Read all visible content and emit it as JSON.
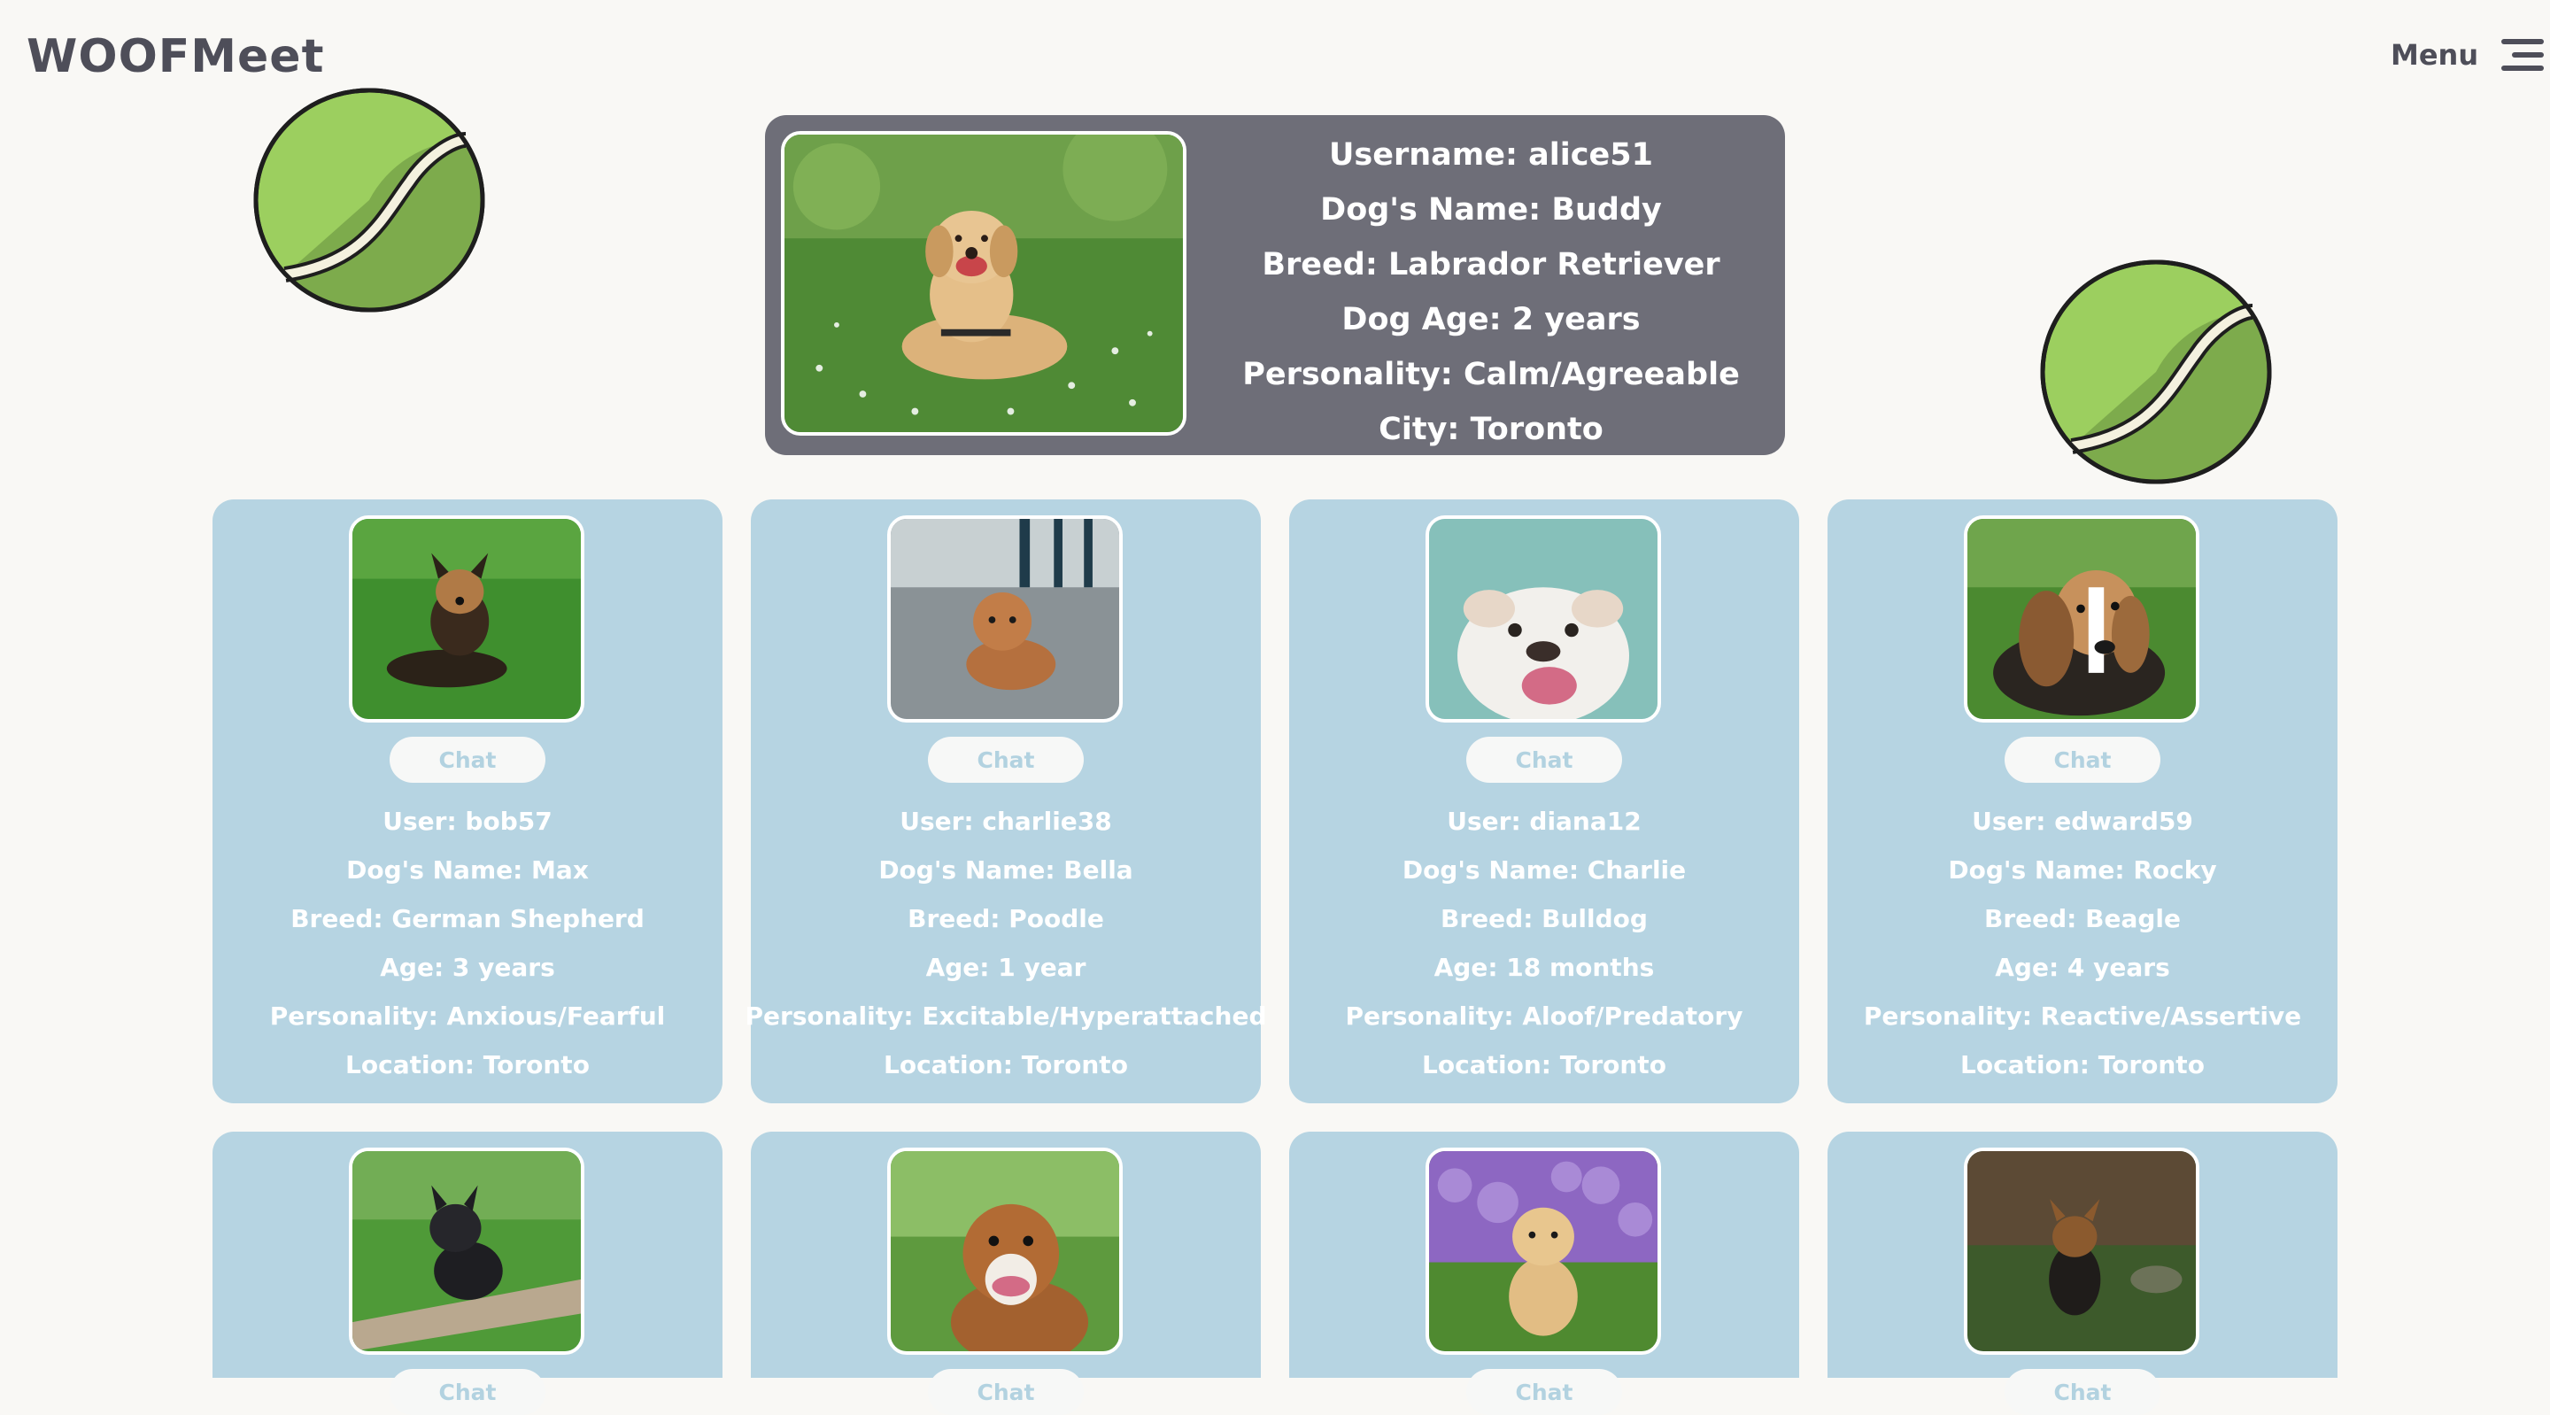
{
  "header": {
    "logo": "WOOFMeet",
    "menu_label": "Menu"
  },
  "featured": {
    "username": "Username: alice51",
    "dog_name": "Dog's Name: Buddy",
    "breed": "Breed: Labrador Retriever",
    "age": "Dog Age: 2 years",
    "personality": "Personality: Calm/Agreeable",
    "city": "City: Toronto"
  },
  "matches": [
    {
      "chat": "Chat",
      "user": "User: bob57",
      "dog": "Dog's Name: Max",
      "breed": "Breed: German Shepherd",
      "age": "Age: 3 years",
      "personality": "Personality: Anxious/Fearful",
      "location": "Location: Toronto"
    },
    {
      "chat": "Chat",
      "user": "User: charlie38",
      "dog": "Dog's Name: Bella",
      "breed": "Breed: Poodle",
      "age": "Age: 1 year",
      "personality": "Personality: Excitable/Hyperattached",
      "location": "Location: Toronto"
    },
    {
      "chat": "Chat",
      "user": "User: diana12",
      "dog": "Dog's Name: Charlie",
      "breed": "Breed: Bulldog",
      "age": "Age: 18 months",
      "personality": "Personality: Aloof/Predatory",
      "location": "Location: Toronto"
    },
    {
      "chat": "Chat",
      "user": "User: edward59",
      "dog": "Dog's Name: Rocky",
      "breed": "Breed: Beagle",
      "age": "Age: 4 years",
      "personality": "Personality: Reactive/Assertive",
      "location": "Location: Toronto"
    },
    {
      "chat": "Chat"
    },
    {
      "chat": "Chat"
    },
    {
      "chat": "Chat"
    },
    {
      "chat": "Chat"
    }
  ],
  "colors": {
    "background": "#f9f8f5",
    "featured_card": "#6e6e78",
    "match_card": "#b6d4e2",
    "chat_text": "#b2d2e0",
    "logo_text": "#4e4e59",
    "ball": "#9ccf5f"
  }
}
